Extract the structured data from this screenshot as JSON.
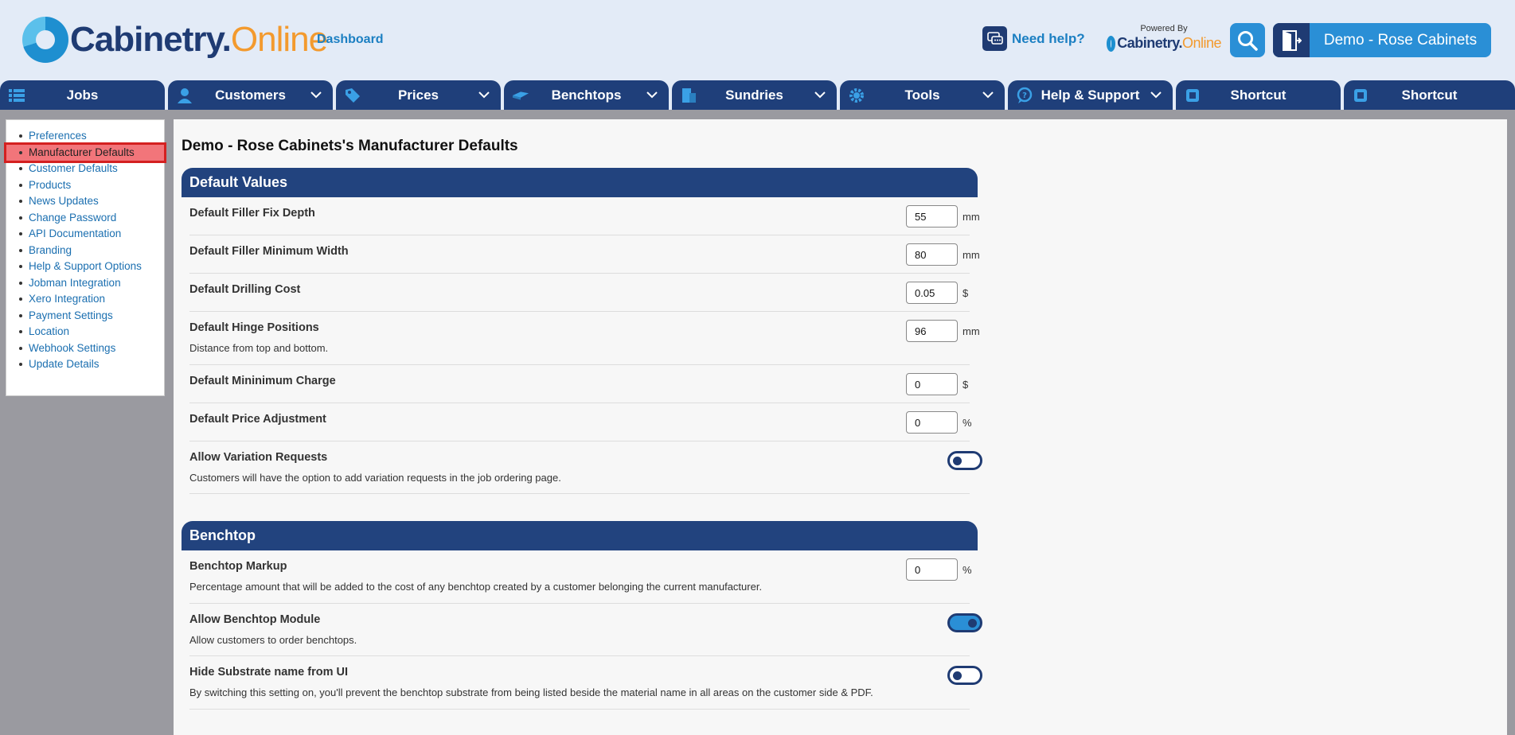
{
  "header": {
    "logo_part1": "Cabinetry.",
    "logo_part2": "Online",
    "dashboard": "Dashboard",
    "need_help": "Need help?",
    "powered_by": "Powered By",
    "powered_logo_part1": "Cabinetry.",
    "powered_logo_part2": "Online",
    "user_name": "Demo - Rose Cabinets"
  },
  "nav": {
    "items": [
      {
        "label": "Jobs",
        "icon": "list-icon"
      },
      {
        "label": "Customers",
        "icon": "person-icon"
      },
      {
        "label": "Prices",
        "icon": "price-tag-icon"
      },
      {
        "label": "Benchtops",
        "icon": "benchtop-icon"
      },
      {
        "label": "Sundries",
        "icon": "sundries-icon"
      },
      {
        "label": "Tools",
        "icon": "gear-icon"
      },
      {
        "label": "Help & Support",
        "icon": "help-chat-icon"
      },
      {
        "label": "Shortcut",
        "icon": "shortcut-icon"
      },
      {
        "label": "Shortcut",
        "icon": "shortcut-icon"
      }
    ]
  },
  "sidebar": {
    "items": [
      "Preferences",
      "Manufacturer Defaults",
      "Customer Defaults",
      "Products",
      "News Updates",
      "Change Password",
      "API Documentation",
      "Branding",
      "Help & Support Options",
      "Jobman Integration",
      "Xero Integration",
      "Payment Settings",
      "Location",
      "Webhook Settings",
      "Update Details"
    ],
    "active_index": 1
  },
  "main": {
    "title": "Demo - Rose Cabinets's Manufacturer Defaults",
    "default_values": {
      "heading": "Default Values",
      "filler_fix_depth": {
        "label": "Default Filler Fix Depth",
        "value": "55",
        "unit": "mm"
      },
      "filler_min_width": {
        "label": "Default Filler Minimum Width",
        "value": "80",
        "unit": "mm"
      },
      "drilling_cost": {
        "label": "Default Drilling Cost",
        "value": "0.05",
        "unit": "$"
      },
      "hinge_positions": {
        "label": "Default Hinge Positions",
        "desc": "Distance from top and bottom.",
        "value": "96",
        "unit": "mm"
      },
      "min_charge": {
        "label": "Default Mininimum Charge",
        "value": "0",
        "unit": "$"
      },
      "price_adjustment": {
        "label": "Default Price Adjustment",
        "value": "0",
        "unit": "%"
      },
      "variation_requests": {
        "label": "Allow Variation Requests",
        "desc": "Customers will have the option to add variation requests in the job ordering page.",
        "enabled": false
      }
    },
    "benchtop": {
      "heading": "Benchtop",
      "markup": {
        "label": "Benchtop Markup",
        "desc": "Percentage amount that will be added to the cost of any benchtop created by a customer belonging the current manufacturer.",
        "value": "0",
        "unit": "%"
      },
      "module": {
        "label": "Allow Benchtop Module",
        "desc": "Allow customers to order benchtops.",
        "enabled": true
      },
      "hide_substrate": {
        "label": "Hide Substrate name from UI",
        "desc": "By switching this setting on, you'll prevent the benchtop substrate from being listed beside the material name in all areas on the customer side & PDF.",
        "enabled": false
      }
    }
  },
  "colors": {
    "nav_bg": "#1f3f7a",
    "accent": "#2a8fd6",
    "logo_orange": "#f39a2e",
    "active_highlight": "#f2757a"
  }
}
